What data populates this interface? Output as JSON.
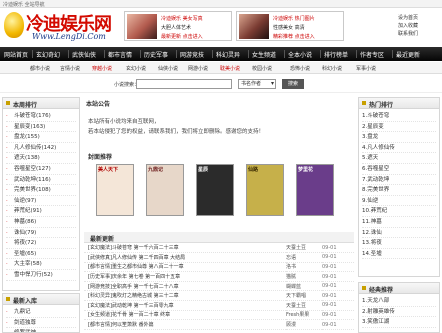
{
  "topbar": {
    "text": "冷迪娱乐 全站导航"
  },
  "logo": {
    "title": "冷迪娱乐网",
    "subtitle": "Www.LengDi.Com"
  },
  "ads": [
    {
      "lines": [
        "冷迪娱乐 美女写真",
        "大胆人体艺术",
        "最新更新 点击进入"
      ]
    },
    {
      "lines": [
        "冷迪娱乐 热门图片",
        "性感美女 高清",
        "精彩推荐 点击进入"
      ]
    }
  ],
  "toplinks": [
    "设为首页",
    "加入收藏",
    "联系我们"
  ],
  "nav": [
    "网站首页",
    "玄幻奇幻",
    "武侠仙侠",
    "都市言情",
    "历史军事",
    "网游竞技",
    "科幻灵异",
    "女生频道",
    "全本小说",
    "排行榜单",
    "作者专区",
    "最近更新"
  ],
  "subnav": [
    {
      "label": "都市小说",
      "hl": false
    },
    {
      "label": "言情小说",
      "hl": false
    },
    {
      "label": "穿越小说",
      "hl": true
    },
    {
      "label": "玄幻小说",
      "hl": false
    },
    {
      "label": "仙侠小说",
      "hl": false
    },
    {
      "label": "网游小说",
      "hl": false
    },
    {
      "label": "耽美小说",
      "hl": true
    },
    {
      "label": "校园小说",
      "hl": false
    },
    {
      "label": "恐怖小说",
      "hl": false
    },
    {
      "label": "科幻小说",
      "hl": false
    },
    {
      "label": "军事小说",
      "hl": false
    }
  ],
  "search": {
    "label": "小说搜索：",
    "value": "",
    "select": "书名作者",
    "button": "搜索"
  },
  "left_panel": {
    "title": "本周排行",
    "items": [
      "斗破苍穹(176)",
      "星辰变(163)",
      "盘龙(155)",
      "凡人修仙传(142)",
      "遮天(138)",
      "吞噬星空(127)",
      "武动乾坤(116)",
      "完美世界(108)",
      "仙逆(97)",
      "莽荒纪(91)",
      "神墓(86)",
      "诛仙(79)",
      "将夜(72)",
      "圣墟(65)",
      "大主宰(58)",
      "雪中悍刀行(52)"
    ]
  },
  "left_panel2": {
    "title": "最新入库",
    "items": [
      "九鼎记",
      "剑道独尊",
      "修罗武神"
    ]
  },
  "notice": {
    "title": "本站公告",
    "lines": [
      "本站所有小说均来自互联网，",
      "若本站侵犯了您的权益，请联系我们，我们将立即删除。感谢您的支持！"
    ]
  },
  "recommend": {
    "title": "封面推荐",
    "covers": [
      {
        "text": "美人天下",
        "bg": "#f4e6d8",
        "fg": "#b00000"
      },
      {
        "text": "九鼎记",
        "bg": "#e7d7c9",
        "fg": "#6b1a1a"
      },
      {
        "text": "星辰",
        "bg": "#2b2b2b",
        "fg": "#ffffff"
      },
      {
        "text": "仙路",
        "bg": "#c6b04a",
        "fg": "#3a2a00"
      },
      {
        "text": "梦里花",
        "bg": "#6a3d8a",
        "fg": "#ffffff"
      }
    ]
  },
  "latest": {
    "title": "最新更新",
    "rows": [
      {
        "cat": "[玄幻魔法]",
        "title": "斗破苍穹 第一千六百二十三章",
        "author": "天蚕土豆",
        "date": "09-01"
      },
      {
        "cat": "[武侠修真]",
        "title": "凡人修仙传 第二千四百章 大结局",
        "author": "忘语",
        "date": "09-01"
      },
      {
        "cat": "[都市言情]",
        "title": "重生之都市仙尊 第八百二十一章",
        "author": "洛书",
        "date": "09-01"
      },
      {
        "cat": "[历史军事]",
        "title": "庆余年 第七卷 第一百四十五章",
        "author": "猫腻",
        "date": "09-01"
      },
      {
        "cat": "[网游竞技]",
        "title": "全职高手 第一千七百二十八章",
        "author": "蝴蝶蓝",
        "date": "09-01"
      },
      {
        "cat": "[科幻灵异]",
        "title": "鬼吹灯之精绝古城 第三十二章",
        "author": "天下霸唱",
        "date": "09-01"
      },
      {
        "cat": "[玄幻魔法]",
        "title": "武动乾坤 第一千三百零九章",
        "author": "天蚕土豆",
        "date": "09-01"
      },
      {
        "cat": "[女生频道]",
        "title": "花千骨 第一百二十章 终章",
        "author": "Fresh果果",
        "date": "09-01"
      },
      {
        "cat": "[都市言情]",
        "title": "何以笙箫默 番外篇",
        "author": "顾漫",
        "date": "09-01"
      }
    ]
  },
  "right_panel": {
    "title": "热门排行",
    "items": [
      "1.斗破苍穹",
      "2.星辰变",
      "3.盘龙",
      "4.凡人修仙传",
      "5.遮天",
      "6.吞噬星空",
      "7.武动乾坤",
      "8.完美世界",
      "9.仙逆",
      "10.莽荒纪",
      "11.神墓",
      "12.诛仙",
      "13.将夜",
      "14.圣墟"
    ]
  },
  "right_panel2": {
    "title": "经典推荐",
    "items": [
      "1.天龙八部",
      "2.射雕英雄传",
      "3.笑傲江湖"
    ]
  }
}
